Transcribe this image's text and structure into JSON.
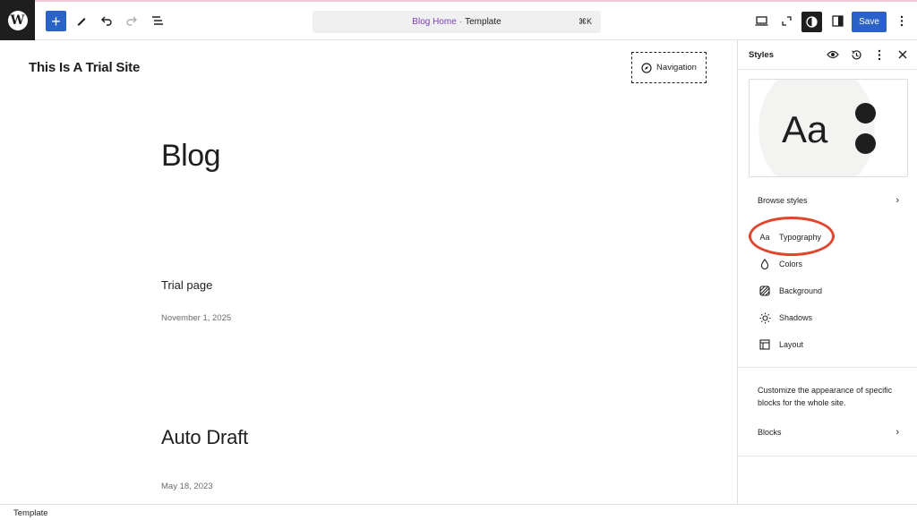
{
  "toolbar": {
    "logo": "W",
    "add_label": "+",
    "command_center": {
      "title": "Blog Home",
      "separator": "·",
      "type": "Template",
      "shortcut": "⌘K"
    },
    "save_label": "Save"
  },
  "canvas": {
    "site_title": "This Is A Trial Site",
    "navigation_label": "Navigation",
    "page_title": "Blog",
    "posts": [
      {
        "title": "Trial page",
        "date": "November 1, 2025"
      },
      {
        "title": "Auto Draft",
        "date": "May 18, 2023"
      }
    ]
  },
  "sidebar": {
    "title": "Styles",
    "preview_text": "Aa",
    "browse_styles": "Browse styles",
    "items": [
      {
        "label": "Typography",
        "icon": "typography-icon"
      },
      {
        "label": "Colors",
        "icon": "droplet-icon"
      },
      {
        "label": "Background",
        "icon": "background-icon"
      },
      {
        "label": "Shadows",
        "icon": "sun-icon"
      },
      {
        "label": "Layout",
        "icon": "layout-icon"
      }
    ],
    "description": "Customize the appearance of specific blocks for the whole site.",
    "blocks_label": "Blocks",
    "typography_icon_text": "Aa"
  },
  "statusbar": {
    "label": "Template"
  },
  "colors": {
    "accent": "#2b62c8",
    "highlight": "#e0462e",
    "command_title": "#7a3db8"
  }
}
